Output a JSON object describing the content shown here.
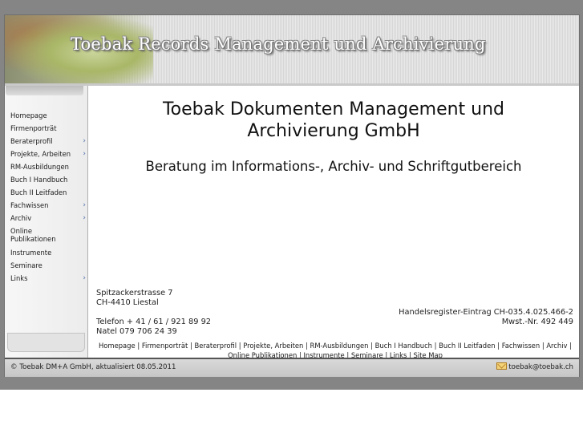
{
  "banner": {
    "title": "Toebak Records Management und Archivierung"
  },
  "menu": [
    {
      "label": "Homepage",
      "has_sub": false
    },
    {
      "label": "Firmenporträt",
      "has_sub": false
    },
    {
      "label": "Beraterprofil",
      "has_sub": true
    },
    {
      "label": "Projekte, Arbeiten",
      "has_sub": true
    },
    {
      "label": "RM-Ausbildungen",
      "has_sub": false
    },
    {
      "label": "Buch I Handbuch",
      "has_sub": false
    },
    {
      "label": "Buch II Leitfaden",
      "has_sub": false
    },
    {
      "label": "Fachwissen",
      "has_sub": true
    },
    {
      "label": "Archiv",
      "has_sub": true
    },
    {
      "label": "Online Publikationen",
      "has_sub": false
    },
    {
      "label": "Instrumente",
      "has_sub": false
    },
    {
      "label": "Seminare",
      "has_sub": false
    },
    {
      "label": "Links",
      "has_sub": true
    }
  ],
  "main": {
    "company_line1": "Toebak Dokumenten Management und",
    "company_line2": "Archivierung GmbH",
    "tagline": "Beratung im Informations-, Archiv- und Schriftgutbereich",
    "street": "Spitzackerstrasse 7",
    "city": "CH-4410 Liestal",
    "phone": "Telefon + 41 / 61 / 921 89 92",
    "mobile": "Natel 079 706 24 39",
    "register": "Handelsregister-Eintrag CH-035.4.025.466-2",
    "vat": "Mwst.-Nr. 492 449"
  },
  "footer_links": [
    "Homepage",
    "Firmenporträt",
    "Beraterprofil",
    "Projekte, Arbeiten",
    "RM-Ausbildungen",
    "Buch I Handbuch",
    "Buch II Leitfaden",
    "Fachwissen",
    "Archiv",
    "Online Publikationen",
    "Instrumente",
    "Seminare",
    "Links",
    "Site Map"
  ],
  "footer_separator": " | ",
  "status": {
    "copyright": "© Toebak DM+A GmbH, aktualisiert 08.05.2011",
    "email": "toebak@toebak.ch",
    "email_icon": "envelope-icon"
  },
  "colors": {
    "page_bg": "#858585",
    "arrow": "#4a6aa8",
    "status_border": "#555555"
  }
}
